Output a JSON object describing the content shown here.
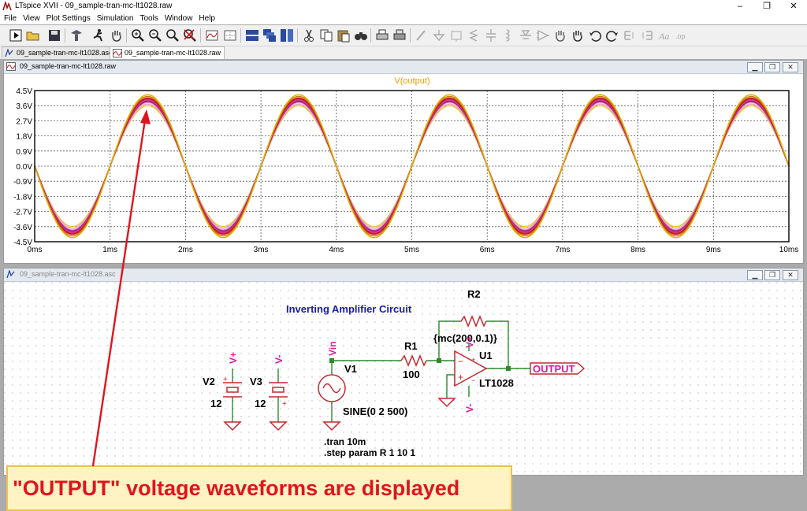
{
  "app": {
    "title": "LTspice XVII - 09_sample-tran-mc-lt1028.raw",
    "window_controls": [
      "–",
      "❐",
      "✕"
    ]
  },
  "menu": [
    "File",
    "View",
    "Plot Settings",
    "Simulation",
    "Tools",
    "Window",
    "Help"
  ],
  "toolbar_icons": [
    "run-icon",
    "open-icon",
    "save-icon",
    "control-panel-icon",
    "halt-icon",
    "pan-icon",
    "zoom-in-icon",
    "zoom-out-icon",
    "zoom-fit-icon",
    "cancel-zoom-icon",
    "autorange-icon",
    "plot-settings-icon",
    "tile-horizontal-icon",
    "cascade-icon",
    "tile-vertical-icon",
    "cut-icon",
    "copy-icon",
    "paste-icon",
    "find-icon",
    "print-icon",
    "print-setup-icon",
    "draw-wire-icon",
    "ground-icon",
    "label-net-icon",
    "resistor-icon",
    "capacitor-icon",
    "inductor-icon",
    "diode-icon",
    "component-icon",
    "move-icon",
    "drag-icon",
    "undo-icon",
    "redo-icon",
    "rotate-icon",
    "mirror-icon",
    "text-icon",
    "spice-directive-icon"
  ],
  "tabs": [
    "09_sample-tran-mc-lt1028.asc",
    "09_sample-tran-mc-lt1028.raw"
  ],
  "plot_window": {
    "title": "09_sample-tran-mc-lt1028.raw",
    "trace_label": "V(output)"
  },
  "schematic_window": {
    "title": "09_sample-tran-mc-lt1028.asc",
    "heading": "Inverting Amplifier Circuit",
    "components": {
      "v2": {
        "name": "V2",
        "value": "12",
        "net": "V+"
      },
      "v3": {
        "name": "V3",
        "value": "12",
        "net": "V-"
      },
      "v1": {
        "name": "V1",
        "value": "SINE(0 2 500)",
        "net": "Vin"
      },
      "r1": {
        "name": "R1",
        "value": "100"
      },
      "r2": {
        "name": "R2",
        "value": "{mc(200,0.1)}"
      },
      "u1": {
        "name": "U1",
        "value": "LT1028"
      },
      "opamp_pos_supply": "V+",
      "opamp_neg_supply": "V-",
      "output_label": "OUTPUT"
    },
    "directives": [
      ".tran 10m",
      ".step param R 1 10 1"
    ]
  },
  "callout": "\"OUTPUT\" voltage waveforms are displayed",
  "colors": {
    "callout_text": "#e0141c",
    "callout_bg": "#fff3c4",
    "trace_label": "#e8a000",
    "net_label": "#e0179a",
    "heading": "#1a1aa8",
    "wire": "#2c8a2c",
    "component": "#c0282e"
  },
  "chart_data": {
    "type": "line",
    "title": "V(output)",
    "xlabel": "",
    "ylabel": "",
    "x_ticks": [
      "0ms",
      "1ms",
      "2ms",
      "3ms",
      "4ms",
      "5ms",
      "6ms",
      "7ms",
      "8ms",
      "9ms",
      "10ms"
    ],
    "y_ticks": [
      "4.5V",
      "3.6V",
      "2.7V",
      "1.8V",
      "0.9V",
      "0.0V",
      "-0.9V",
      "-1.8V",
      "-2.7V",
      "-3.6V",
      "-4.5V"
    ],
    "xlim": [
      0,
      10
    ],
    "ylim": [
      -4.5,
      4.5
    ],
    "x_unit": "ms",
    "grid": true,
    "waveform": "-A*sin(2*pi*0.5*t_ms)",
    "series": [
      {
        "amplitude": 3.6,
        "color": "#f2c230"
      },
      {
        "amplitude": 3.7,
        "color": "#e8a8c8"
      },
      {
        "amplitude": 3.8,
        "color": "#d88ab8"
      },
      {
        "amplitude": 3.85,
        "color": "#b21e8e"
      },
      {
        "amplitude": 3.9,
        "color": "#8a2a8a"
      },
      {
        "amplitude": 3.95,
        "color": "#e04a8a"
      },
      {
        "amplitude": 4.0,
        "color": "#d61a5a"
      },
      {
        "amplitude": 4.05,
        "color": "#c4161c"
      },
      {
        "amplitude": 4.15,
        "color": "#c87a00"
      },
      {
        "amplitude": 4.25,
        "color": "#e0b000"
      }
    ]
  }
}
